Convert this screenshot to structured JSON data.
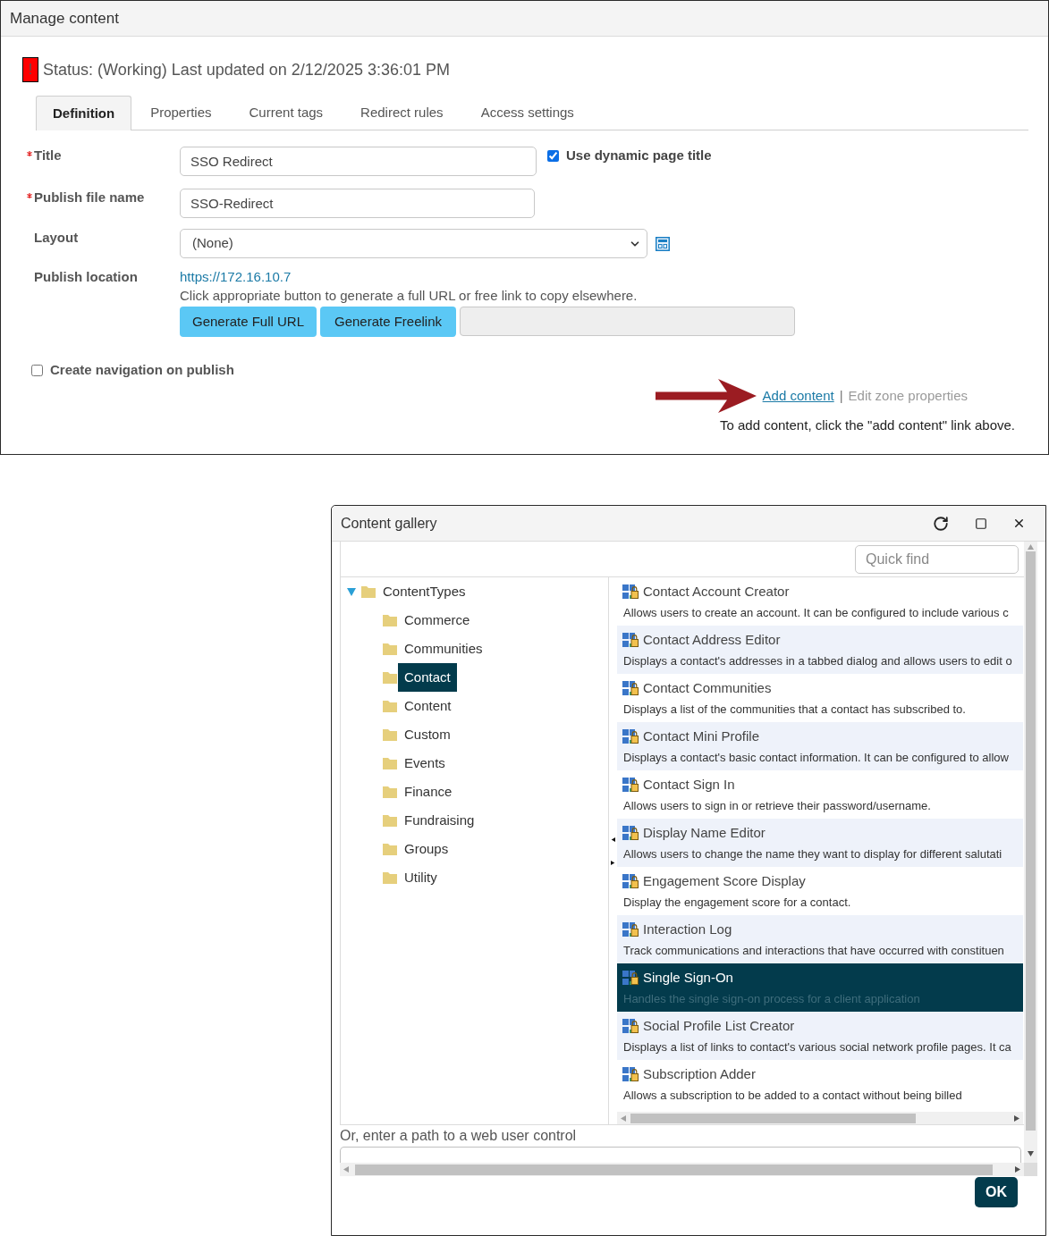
{
  "manage_content": {
    "title": "Manage content",
    "status": {
      "flag": "!",
      "text": "Status: (Working) Last updated on 2/12/2025 3:36:01 PM"
    },
    "tabs": [
      {
        "label": "Definition",
        "selected": true
      },
      {
        "label": "Properties",
        "selected": false
      },
      {
        "label": "Current tags",
        "selected": false
      },
      {
        "label": "Redirect rules",
        "selected": false
      },
      {
        "label": "Access settings",
        "selected": false
      }
    ],
    "fields": [
      {
        "kind": "text",
        "label": "Title",
        "required": true,
        "value": "SSO Redirect",
        "option": {
          "label": "Use dynamic page title",
          "checked": true
        }
      },
      {
        "kind": "text",
        "label": "Publish file name",
        "required": true,
        "value": "SSO-Redirect"
      },
      {
        "kind": "select",
        "label": "Layout",
        "required": false,
        "value": "(None)"
      },
      {
        "kind": "location",
        "label": "Publish location",
        "required": false,
        "url": "https://172.16.10.7",
        "hint": "Click appropriate button to generate a full URL or free link to copy elsewhere.",
        "buttons": [
          "Generate Full URL",
          "Generate Freelink"
        ]
      }
    ],
    "create_navigation": {
      "label": "Create navigation on publish",
      "checked": false
    },
    "zone_links": [
      {
        "label": "Add content",
        "disabled": false
      },
      {
        "label": "Edit zone properties",
        "disabled": true
      }
    ],
    "separator": "|",
    "instruction": "To add content, click the \"add content\" link above."
  },
  "content_gallery": {
    "title": "Content gallery",
    "quick_find": {
      "placeholder": "Quick find"
    },
    "tree": {
      "label": "ContentTypes",
      "expanded": true,
      "selected": false,
      "children": [
        {
          "label": "Commerce",
          "selected": false
        },
        {
          "label": "Communities",
          "selected": false
        },
        {
          "label": "Contact",
          "selected": true
        },
        {
          "label": "Content",
          "selected": false
        },
        {
          "label": "Custom",
          "selected": false
        },
        {
          "label": "Events",
          "selected": false
        },
        {
          "label": "Finance",
          "selected": false
        },
        {
          "label": "Fundraising",
          "selected": false
        },
        {
          "label": "Groups",
          "selected": false
        },
        {
          "label": "Utility",
          "selected": false
        }
      ]
    },
    "items": [
      {
        "title": "Contact Account Creator",
        "description": "Allows users to create an account. It can be configured to include various c",
        "selected": false
      },
      {
        "title": "Contact Address Editor",
        "description": "Displays a contact's addresses in a tabbed dialog and allows users to edit o",
        "selected": false
      },
      {
        "title": "Contact Communities",
        "description": "Displays a list of the communities that a contact has subscribed to.",
        "selected": false
      },
      {
        "title": "Contact Mini Profile",
        "description": "Displays a contact's basic contact information. It can be configured to allow",
        "selected": false
      },
      {
        "title": "Contact Sign In",
        "description": "Allows users to sign in or retrieve their password/username.",
        "selected": false
      },
      {
        "title": "Display Name Editor",
        "description": "Allows users to change the name they want to display for different salutati",
        "selected": false
      },
      {
        "title": "Engagement Score Display",
        "description": "Display the engagement score for a contact.",
        "selected": false
      },
      {
        "title": "Interaction Log",
        "description": "Track communications and interactions that have occurred with constituen",
        "selected": false
      },
      {
        "title": "Single Sign-On",
        "description": "Handles the single sign-on process for a client application",
        "selected": true
      },
      {
        "title": "Social Profile List Creator",
        "description": "Displays a list of links to contact's various social network profile pages. It ca",
        "selected": false
      },
      {
        "title": "Subscription Adder",
        "description": "Allows a subscription to be added to a contact without being billed",
        "selected": false
      }
    ],
    "path_field": {
      "label": "Or, enter a path to a web user control"
    },
    "ok_button": "OK"
  }
}
